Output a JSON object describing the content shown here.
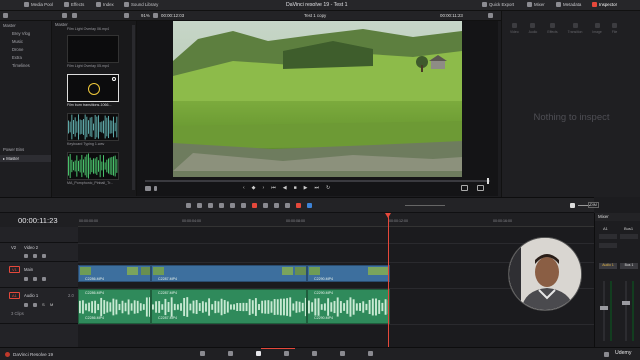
{
  "topbar": {
    "media_pool": "Media Pool",
    "effects": "Effects",
    "index": "Index",
    "sound_library": "Sound Library",
    "title": "DaVinci resolve 19 - Test 1",
    "quick_export": "Quick Export",
    "mixer": "Mixer",
    "metadata": "Metadata",
    "inspector": "Inspector"
  },
  "viewer": {
    "zoom": "91%",
    "source_tc": "00:00:12:03",
    "clip_name": "Test 1 copy",
    "record_tc": "00:00:11:23"
  },
  "inspector": {
    "tabs": [
      "Video",
      "Audio",
      "Effects",
      "Transition",
      "Image",
      "File"
    ],
    "empty_text": "Nothing to inspect"
  },
  "sidebar": {
    "master": "Master",
    "bins": [
      "Brey Vlog",
      "Music",
      "Drone",
      "Extra",
      "Timelines"
    ],
    "power_bins": "Power Bins",
    "power_master": "Master"
  },
  "media_pool": {
    "breadcrumb": "Master",
    "items": [
      {
        "name": "Film Light Overlay 06.mp4"
      },
      {
        "name": "Film Light Overlay 05.mp4"
      },
      {
        "name": "Film burn transitions-1066..."
      },
      {
        "name": "Keyboard Typing 1.wav"
      },
      {
        "name": "MA_Pomphonic_Pinball_Tr..."
      }
    ]
  },
  "timeline": {
    "timecode": "00:00:11:23",
    "ruler": [
      "00:00:00:00",
      "00:00:04:00",
      "00:00:08:00",
      "00:00:12:00",
      "00:00:16:00"
    ],
    "tracks": {
      "v2": {
        "id": "V2",
        "name": "Video 2"
      },
      "v1": {
        "id": "V1",
        "name": "Main"
      },
      "a1": {
        "id": "A1",
        "name": "Audio 1",
        "level": "2.0",
        "clips_count": "3 Clips"
      }
    },
    "video_clips": [
      "C2286.MP4",
      "C2287.MP4",
      "C2290.MP4"
    ],
    "audio_clips": [
      "C2286.MP4",
      "C2287.MP4",
      "C2290.MP4"
    ],
    "dim_label": "DIM"
  },
  "mixer": {
    "title": "Mixer",
    "channels": [
      "A1",
      "Bus1"
    ],
    "audio_btn": "Audio 1",
    "bus_btn": "Bus 1"
  },
  "footer": {
    "app_name": "DaVinci Resolve 19",
    "watermark": "Udemy"
  },
  "colors": {
    "accent_red": "#e5483b",
    "video_clip": "#3d6f9e",
    "audio_clip": "#2f8a5b"
  }
}
